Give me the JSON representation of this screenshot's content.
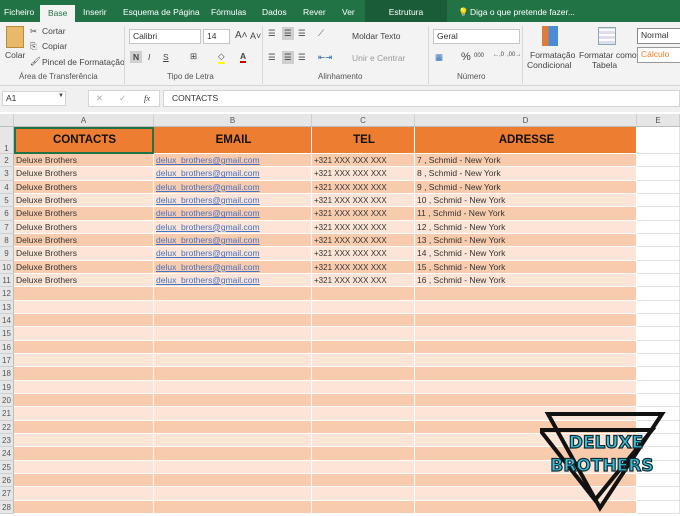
{
  "tabs": [
    "Ficheiro",
    "Base",
    "Inserir",
    "Esquema de Página",
    "Fórmulas",
    "Dados",
    "Rever",
    "Ver"
  ],
  "context_tab": "Estrutura",
  "tell_me": "Diga o que pretende fazer...",
  "clipboard": {
    "paste": "Colar",
    "cut": "Cortar",
    "copy": "Copiar",
    "painter": "Pincel de Formatação",
    "group": "Área de Transferência"
  },
  "font": {
    "name": "Calibri",
    "size": "14",
    "bold": "N",
    "italic": "I",
    "underline": "S",
    "group": "Tipo de Letra"
  },
  "alignment": {
    "wrap": "Moldar Texto",
    "merge": "Unir e Centrar",
    "group": "Alinhamento"
  },
  "number": {
    "format": "Geral",
    "percent": "%",
    "thousands": "000",
    "group": "Número"
  },
  "styles": {
    "conditional": "Formatação",
    "conditional2": "Condicional",
    "table": "Formatar como",
    "table2": "Tabela",
    "normal": "Normal",
    "calc": "Cálculo"
  },
  "formula_bar": {
    "name_box": "A1",
    "fx": "fx",
    "value": "CONTACTS"
  },
  "columns": [
    "A",
    "B",
    "C",
    "D",
    "E"
  ],
  "headers": [
    "CONTACTS",
    "EMAIL",
    "TEL",
    "ADRESSE"
  ],
  "rows": [
    [
      "Deluxe Brothers",
      "delux_brothers@gmail.com",
      "+321 XXX XXX XXX",
      "7 , Schmid - New York"
    ],
    [
      "Deluxe Brothers",
      "delux_brothers@gmail.com",
      "+321 XXX XXX XXX",
      "8 , Schmid - New York"
    ],
    [
      "Deluxe Brothers",
      "delux_brothers@gmail.com",
      "+321 XXX XXX XXX",
      "9 , Schmid - New York"
    ],
    [
      "Deluxe Brothers",
      "delux_brothers@gmail.com",
      "+321 XXX XXX XXX",
      "10 , Schmid - New York"
    ],
    [
      "Deluxe Brothers",
      "delux_brothers@gmail.com",
      "+321 XXX XXX XXX",
      "11 , Schmid - New York"
    ],
    [
      "Deluxe Brothers",
      "delux_brothers@gmail.com",
      "+321 XXX XXX XXX",
      "12 , Schmid - New York"
    ],
    [
      "Deluxe Brothers",
      "delux_brothers@gmail.com",
      "+321 XXX XXX XXX",
      "13 , Schmid - New York"
    ],
    [
      "Deluxe Brothers",
      "delux_brothers@gmail.com",
      "+321 XXX XXX XXX",
      "14 , Schmid - New York"
    ],
    [
      "Deluxe Brothers",
      "delux_brothers@gmail.com",
      "+321 XXX XXX XXX",
      "15 , Schmid - New York"
    ],
    [
      "Deluxe Brothers",
      "delux_brothers@gmail.com",
      "+321 XXX XXX XXX",
      "16 , Schmid - New York"
    ]
  ],
  "row_count": 28,
  "logo": {
    "line1": "DELUXE",
    "line2": "BROTHERS"
  },
  "colors": {
    "accent": "#217346",
    "header": "#ed7d31",
    "band_dark": "#f8cbad",
    "band_light": "#fce4d6",
    "logo": "#3bbfd8"
  }
}
